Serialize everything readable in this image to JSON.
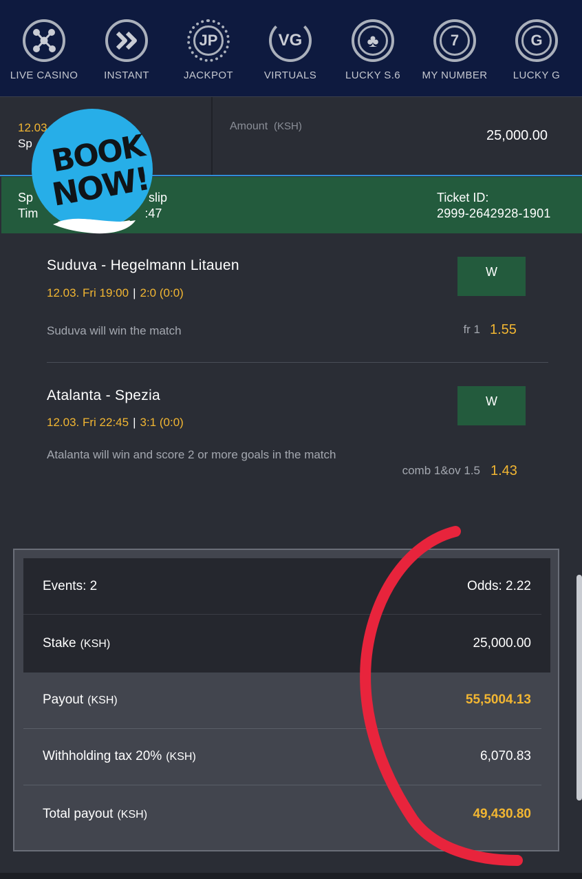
{
  "nav": {
    "items": [
      {
        "label": "LIVE CASINO",
        "icon": "network-icon"
      },
      {
        "label": "INSTANT",
        "icon": "fast-forward-icon"
      },
      {
        "label": "JACKPOT",
        "icon": "jp-seal-icon",
        "glyph": "JP"
      },
      {
        "label": "VIRTUALS",
        "icon": "vg-icon",
        "glyph": "VG"
      },
      {
        "label": "LUCKY S.6",
        "icon": "clover-icon",
        "glyph": "♣"
      },
      {
        "label": "MY NUMBER",
        "icon": "number-seven-icon",
        "glyph": "7"
      },
      {
        "label": "LUCKY G",
        "icon": "letter-g-icon",
        "glyph": "G"
      }
    ]
  },
  "amount": {
    "date_partial": "12.03",
    "sport_partial": "Sp",
    "label": "Amount",
    "currency": "(KSH)",
    "value": "25,000.00"
  },
  "ticket": {
    "left_line1_a": "Sp",
    "left_line1_b": "slip",
    "left_line2_a": "Tim",
    "left_line2_b": ":47",
    "id_label": "Ticket ID:",
    "id_value": "2999-2642928-1901"
  },
  "badge": {
    "line1": "BOOK",
    "line2": "NOW!"
  },
  "events": [
    {
      "title": "Suduva - Hegelmann Litauen",
      "datetime": "12.03. Fri 19:00",
      "score": "2:0 (0:0)",
      "description": "Suduva will win the match",
      "market": "fr 1",
      "odd": "1.55",
      "status": "W"
    },
    {
      "title": "Atalanta - Spezia",
      "datetime": "12.03. Fri 22:45",
      "score": "3:1 (0:0)",
      "description": "Atalanta will win and score 2 or more goals in the match",
      "market": "comb 1&ov 1.5",
      "odd": "1.43",
      "status": "W"
    }
  ],
  "summary": {
    "events_label": "Events: 2",
    "odds_label": "Odds: 2.22",
    "stake_label": "Stake",
    "stake_currency": "(KSH)",
    "stake_value": "25,000.00",
    "payout_label": "Payout",
    "payout_currency": "(KSH)",
    "payout_value": "55,5004.13",
    "tax_label": "Withholding tax 20%",
    "tax_currency": "(KSH)",
    "tax_value": "6,070.83",
    "total_label": "Total payout",
    "total_currency": "(KSH)",
    "total_value": "49,430.80"
  },
  "colors": {
    "nav_bg": "#0e1a3f",
    "ticket_green": "#235b3d",
    "gold": "#f2b632",
    "badge_blue": "#27aee8",
    "annotation_red": "#e8243c"
  }
}
